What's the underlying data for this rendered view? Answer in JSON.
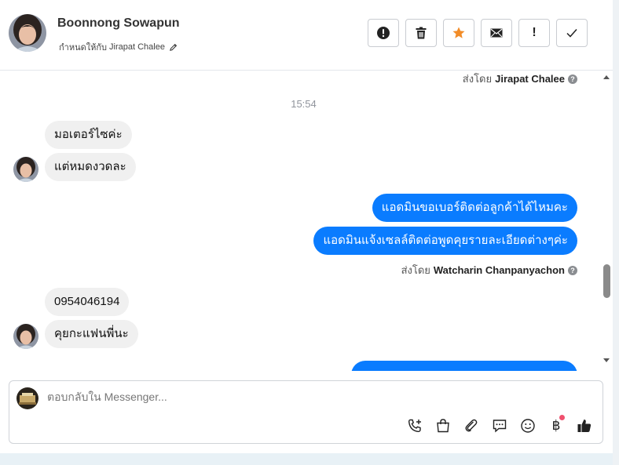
{
  "header": {
    "contact_name": "Boonnong Sowapun",
    "assign_prefix": "กำหนดให้กับ",
    "assign_to": "Jirapat Chalee"
  },
  "actions": [
    {
      "name": "spam-button",
      "icon": "alert-circle-icon"
    },
    {
      "name": "delete-button",
      "icon": "trash-icon"
    },
    {
      "name": "star-button",
      "icon": "star-icon",
      "color": "#f28c28"
    },
    {
      "name": "mark-unread-button",
      "icon": "envelope-icon"
    },
    {
      "name": "follow-up-button",
      "icon": "exclamation-icon",
      "label": "!"
    },
    {
      "name": "done-button",
      "icon": "check-icon"
    }
  ],
  "conversation": {
    "sent_by_top": {
      "prefix": "ส่งโดย",
      "name": "Jirapat Chalee"
    },
    "timestamp": "15:54",
    "group1": [
      "มอเตอร์ไซค่ะ",
      "แต่หมดงวดละ"
    ],
    "outgoing1": [
      "แอดมินขอเบอร์ติดต่อลูกค้าได้ไหมคะ",
      "แอดมินแจ้งเซลล์ติดต่อพูดคุยรายละเอียดต่างๆค่ะ"
    ],
    "sent_by_mid": {
      "prefix": "ส่งโดย",
      "name": "Watcharin Chanpanyachon"
    },
    "group2": [
      "0954046194",
      "คุยกะแฟนพี่นะ"
    ]
  },
  "composer": {
    "placeholder": "ตอบกลับใน Messenger...",
    "tools": [
      "phone-add-icon",
      "shopping-bag-icon",
      "paperclip-icon",
      "chat-bubble-icon",
      "emoji-icon",
      "baht-icon",
      "thumbs-up-icon"
    ],
    "baht_symbol": "฿"
  },
  "colors": {
    "outgoing": "#0a7cff",
    "incoming": "#f0f0f0",
    "star": "#f28c28",
    "notification_dot": "#f0506e"
  }
}
